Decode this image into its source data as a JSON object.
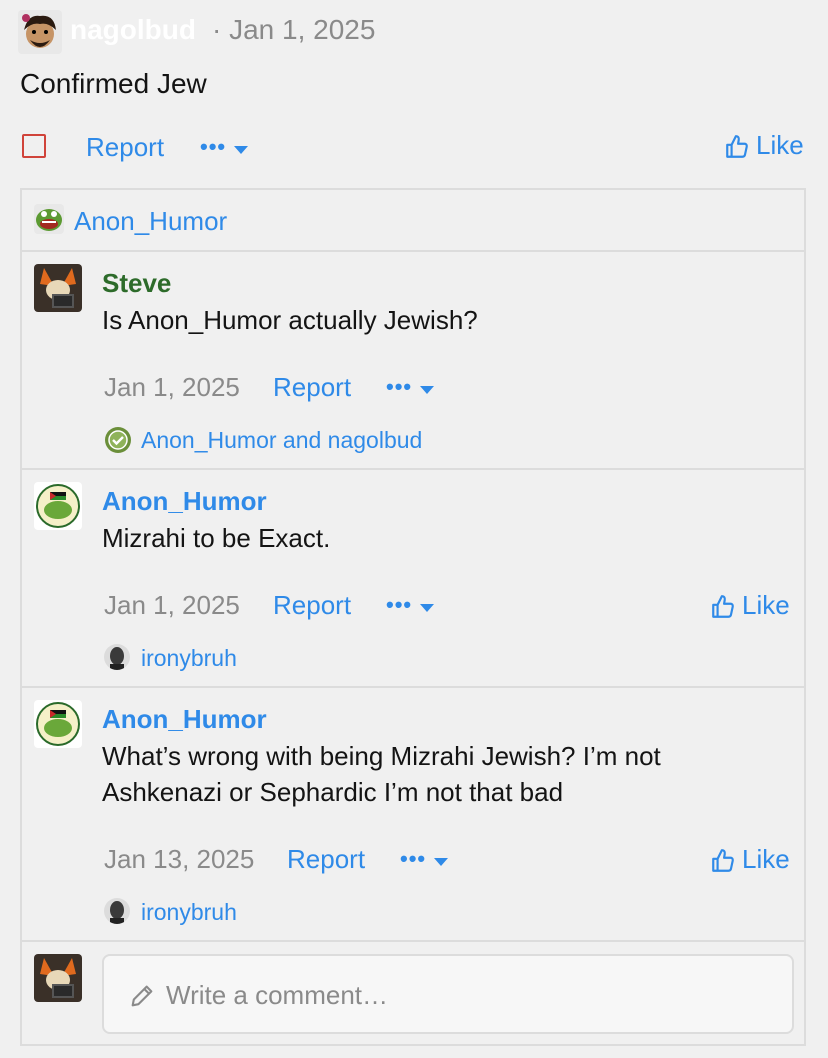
{
  "post": {
    "author": "nagolbud",
    "date_separator": " · ",
    "date": "Jan 1, 2025",
    "body": "Confirmed Jew",
    "report_label": "Report",
    "more_label": "•••",
    "like_label": "Like"
  },
  "thread": {
    "parent_author": "Anon_Humor",
    "comments": [
      {
        "author": "Steve",
        "text": "Is Anon_Humor actually Jewish?",
        "date": "Jan 1, 2025",
        "report_label": "Report",
        "more_label": "•••",
        "reactions": "Anon_Humor and nagolbud"
      },
      {
        "author": "Anon_Humor",
        "text": "Mizrahi to be Exact.",
        "date": "Jan 1, 2025",
        "report_label": "Report",
        "more_label": "•••",
        "like_label": "Like",
        "reactions": "ironybruh"
      },
      {
        "author": "Anon_Humor",
        "text": "What’s wrong with being Mizrahi Jewish? I’m not Ashkenazi or Sephardic I’m not that bad",
        "date": "Jan 13, 2025",
        "report_label": "Report",
        "more_label": "•••",
        "like_label": "Like",
        "reactions": "ironybruh"
      }
    ],
    "comment_input": {
      "placeholder": "Write a comment…"
    }
  },
  "colors": {
    "link": "#2f8ae8",
    "username_green": "#2d6b2a",
    "checkbox_border": "#d0433a",
    "background": "#f0f0f0"
  }
}
